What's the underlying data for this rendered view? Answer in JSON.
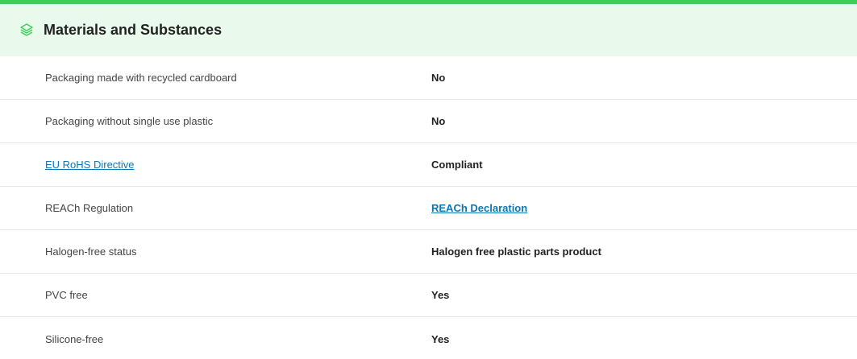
{
  "section": {
    "title": "Materials and Substances",
    "icon": "layers-icon",
    "accent_color": "#3dcd58",
    "header_bg": "#e9f9ec",
    "link_color": "#0b77b5"
  },
  "rows": [
    {
      "label": "Packaging made with recycled cardboard",
      "value": "No"
    },
    {
      "label": "Packaging without single use plastic",
      "value": "No"
    },
    {
      "label": "EU RoHS Directive",
      "value": "Compliant"
    },
    {
      "label": "REACh Regulation",
      "value": "REACh Declaration"
    },
    {
      "label": "Halogen-free status",
      "value": "Halogen free plastic parts product"
    },
    {
      "label": "PVC free",
      "value": "Yes"
    },
    {
      "label": "Silicone-free",
      "value": "Yes"
    }
  ]
}
